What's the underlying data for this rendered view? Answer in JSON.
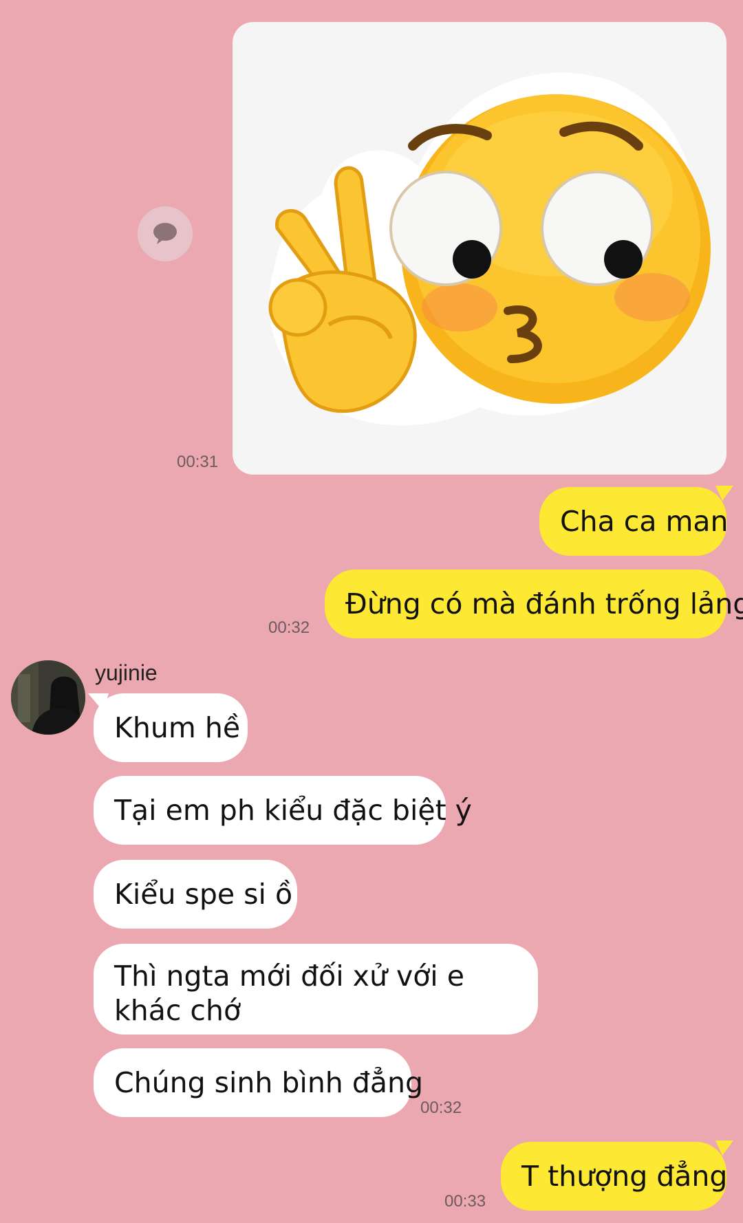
{
  "chat": {
    "sticker": {
      "emoji": "face-with-peace-sign-sticker",
      "time": "00:31"
    },
    "outgoing_group_1": {
      "messages": [
        "Cha ca man",
        "Đừng có mà đánh trống lảng"
      ],
      "time": "00:32"
    },
    "incoming_group": {
      "sender": "yujinie",
      "messages": [
        "Khum hề",
        "Tại em ph kiểu đặc biệt ý",
        "Kiểu spe si ồ",
        "Thì ngta mới đối xử với e khác chớ",
        "Chúng sinh bình đẳng"
      ],
      "time": "00:32"
    },
    "outgoing_group_2": {
      "messages": [
        "T thượng đẳng"
      ],
      "time": "00:33"
    }
  },
  "colors": {
    "background": "#eca8b1",
    "outgoing_bubble": "#fde834",
    "incoming_bubble": "#ffffff"
  },
  "icons": {
    "reply": "speech-bubble-icon",
    "avatar": "user-avatar"
  }
}
